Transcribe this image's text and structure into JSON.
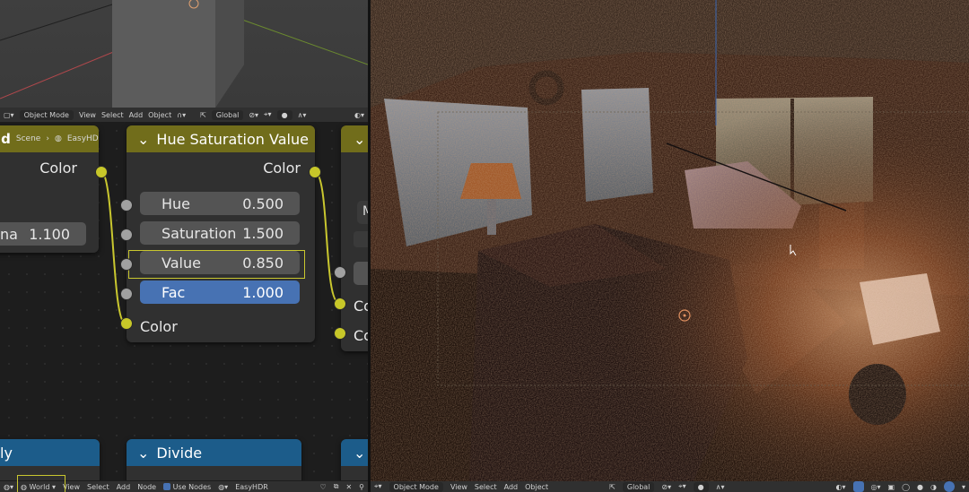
{
  "top_header": {
    "mode": "Object Mode",
    "menus": [
      "View",
      "Select",
      "Add",
      "Object"
    ],
    "orientation": "Global"
  },
  "node_world": {
    "breadcrumb_scene": "Scene",
    "breadcrumb_world": "EasyHDR",
    "title_fragment": "ld",
    "output_label": "Color",
    "field_label": "na",
    "field_value": "1.100"
  },
  "node_hue": {
    "title": "Hue Saturation Value",
    "output_label": "Color",
    "inputs": [
      {
        "label": "Hue",
        "value": "0.500"
      },
      {
        "label": "Saturation",
        "value": "1.500"
      },
      {
        "label": "Value",
        "value": "0.850"
      },
      {
        "label": "Fac",
        "value": "1.000"
      }
    ],
    "input_color_label": "Color"
  },
  "node_right": {
    "field_fragment": "M",
    "input1": "Co",
    "input2": "Co"
  },
  "bottom_nodes": {
    "left_title": "ly",
    "divide_title": "Divide"
  },
  "node_footer": {
    "type": "World",
    "menus": [
      "View",
      "Select",
      "Add",
      "Node"
    ],
    "use_nodes_label": "Use Nodes",
    "world_name": "EasyHDR"
  },
  "render_footer": {
    "mode": "Object Mode",
    "menus": [
      "View",
      "Select",
      "Add",
      "Object"
    ],
    "orientation": "Global"
  },
  "colors": {
    "socket_yellow": "#c7c729",
    "socket_grey": "#a1a1a1",
    "header_olive": "#716d1b",
    "header_blue": "#1c5c8a",
    "fac_blue": "#4772b3",
    "selection_outline": "#c9c72f"
  }
}
